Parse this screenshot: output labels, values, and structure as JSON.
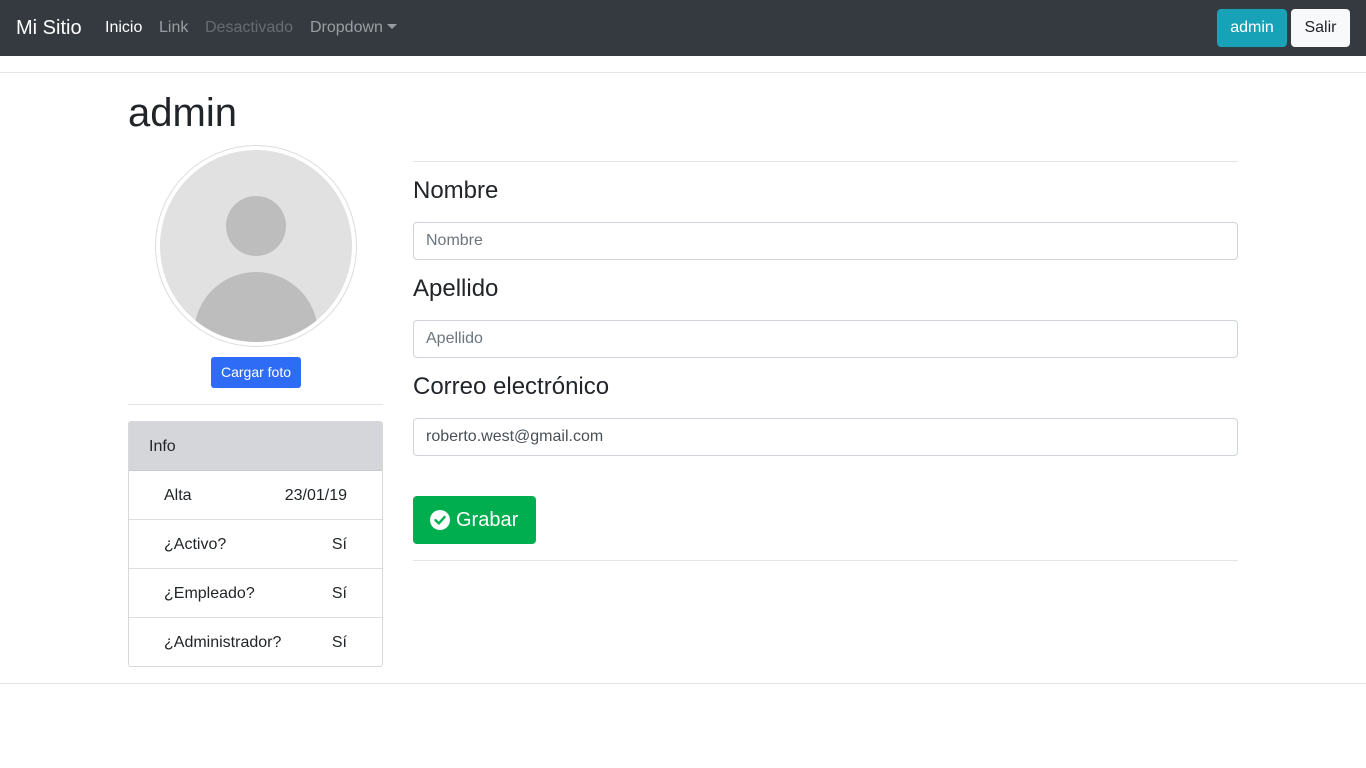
{
  "navbar": {
    "brand": "Mi Sitio",
    "links": {
      "home": "Inicio",
      "link": "Link",
      "disabled": "Desactivado",
      "dropdown": "Dropdown"
    },
    "user_button": "admin",
    "logout_button": "Salir"
  },
  "page": {
    "title": "admin"
  },
  "profile": {
    "upload_button": "Cargar foto",
    "info": {
      "header": "Info",
      "rows": [
        {
          "label": "Alta",
          "value": "23/01/19"
        },
        {
          "label": "¿Activo?",
          "value": "Sí"
        },
        {
          "label": "¿Empleado?",
          "value": "Sí"
        },
        {
          "label": "¿Administrador?",
          "value": "Sí"
        }
      ]
    }
  },
  "form": {
    "first_name": {
      "label": "Nombre",
      "placeholder": "Nombre",
      "value": ""
    },
    "last_name": {
      "label": "Apellido",
      "placeholder": "Apellido",
      "value": ""
    },
    "email": {
      "label": "Correo electrónico",
      "placeholder": "",
      "value": "roberto.west@gmail.com"
    },
    "save_button": "Grabar"
  },
  "colors": {
    "navbar_bg": "#343a40",
    "user_button": "#17a2b8",
    "upload_button": "#2f6cf6",
    "save_button": "#00ad4f"
  },
  "icons": {
    "avatar": "user-silhouette-icon",
    "dropdown": "chevron-down-icon",
    "save": "check-circle-icon"
  }
}
